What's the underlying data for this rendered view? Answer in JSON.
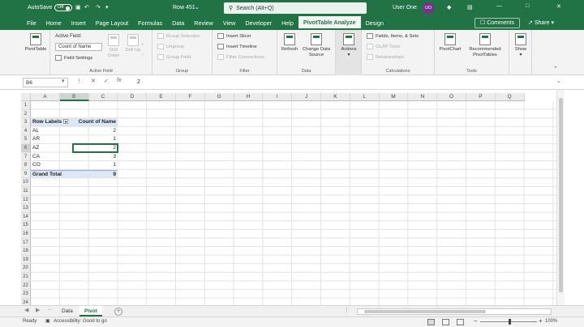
{
  "titlebar": {
    "autosave_label": "AutoSave",
    "autosave_state": "Off",
    "doc_title": "Row 451",
    "search_placeholder": "Search (Alt+Q)",
    "user_name": "User One",
    "user_initials": "UO"
  },
  "menu": {
    "tabs": [
      "File",
      "Home",
      "Insert",
      "Page Layout",
      "Formulas",
      "Data",
      "Review",
      "View",
      "Developer",
      "Help",
      "PivotTable Analyze",
      "Design"
    ],
    "active_index": 10,
    "comments_label": "Comments",
    "share_label": "Share"
  },
  "ribbon": {
    "pivottable_btn": "PivotTable",
    "active_field_label": "Active Field:",
    "active_field_value": "Count of Name",
    "field_settings": "Field Settings",
    "drill_down": "Drill Down",
    "drill_up": "Drill Up",
    "active_field_group": "Active Field",
    "group_selection": "Group Selection",
    "ungroup": "Ungroup",
    "group_field": "Group Field",
    "group_group": "Group",
    "insert_slicer": "Insert Slicer",
    "insert_timeline": "Insert Timeline",
    "filter_connections": "Filter Connections",
    "filter_group": "Filter",
    "refresh": "Refresh",
    "change_data_source": "Change Data Source",
    "data_group": "Data",
    "actions": "Actions",
    "fields_items_sets": "Fields, Items, & Sets",
    "olap_tools": "OLAP Tools",
    "relationships": "Relationships",
    "calculations_group": "Calculations",
    "pivotchart": "PivotChart",
    "recommended_pivottables": "Recommended PivotTables",
    "tools_group": "Tools",
    "show": "Show"
  },
  "formula_bar": {
    "name_box": "B6",
    "formula": "2"
  },
  "grid": {
    "columns": [
      "A",
      "B",
      "C",
      "D",
      "E",
      "F",
      "G",
      "H",
      "I",
      "J",
      "K",
      "L",
      "M",
      "N",
      "O",
      "P",
      "Q"
    ],
    "rows": [
      "1",
      "2",
      "3",
      "4",
      "5",
      "6",
      "7",
      "8",
      "9",
      "10",
      "11",
      "12",
      "13",
      "14",
      "15",
      "16",
      "17",
      "18",
      "19",
      "20",
      "21",
      "22",
      "23",
      "24"
    ],
    "selected_col": "B",
    "selected_row": "6"
  },
  "pivot": {
    "header_row_labels": "Row Labels",
    "header_count": "Count of Name",
    "rows": [
      {
        "label": "AL",
        "value": "2"
      },
      {
        "label": "AR",
        "value": "1"
      },
      {
        "label": "AZ",
        "value": "2"
      },
      {
        "label": "CA",
        "value": "3"
      },
      {
        "label": "CO",
        "value": "1"
      }
    ],
    "total_label": "Grand Total",
    "total_value": "9"
  },
  "sheets": {
    "tabs": [
      "Data",
      "Pivot"
    ],
    "active_index": 1
  },
  "status": {
    "ready": "Ready",
    "accessibility": "Accessibility: Good to go",
    "zoom": "100%"
  }
}
